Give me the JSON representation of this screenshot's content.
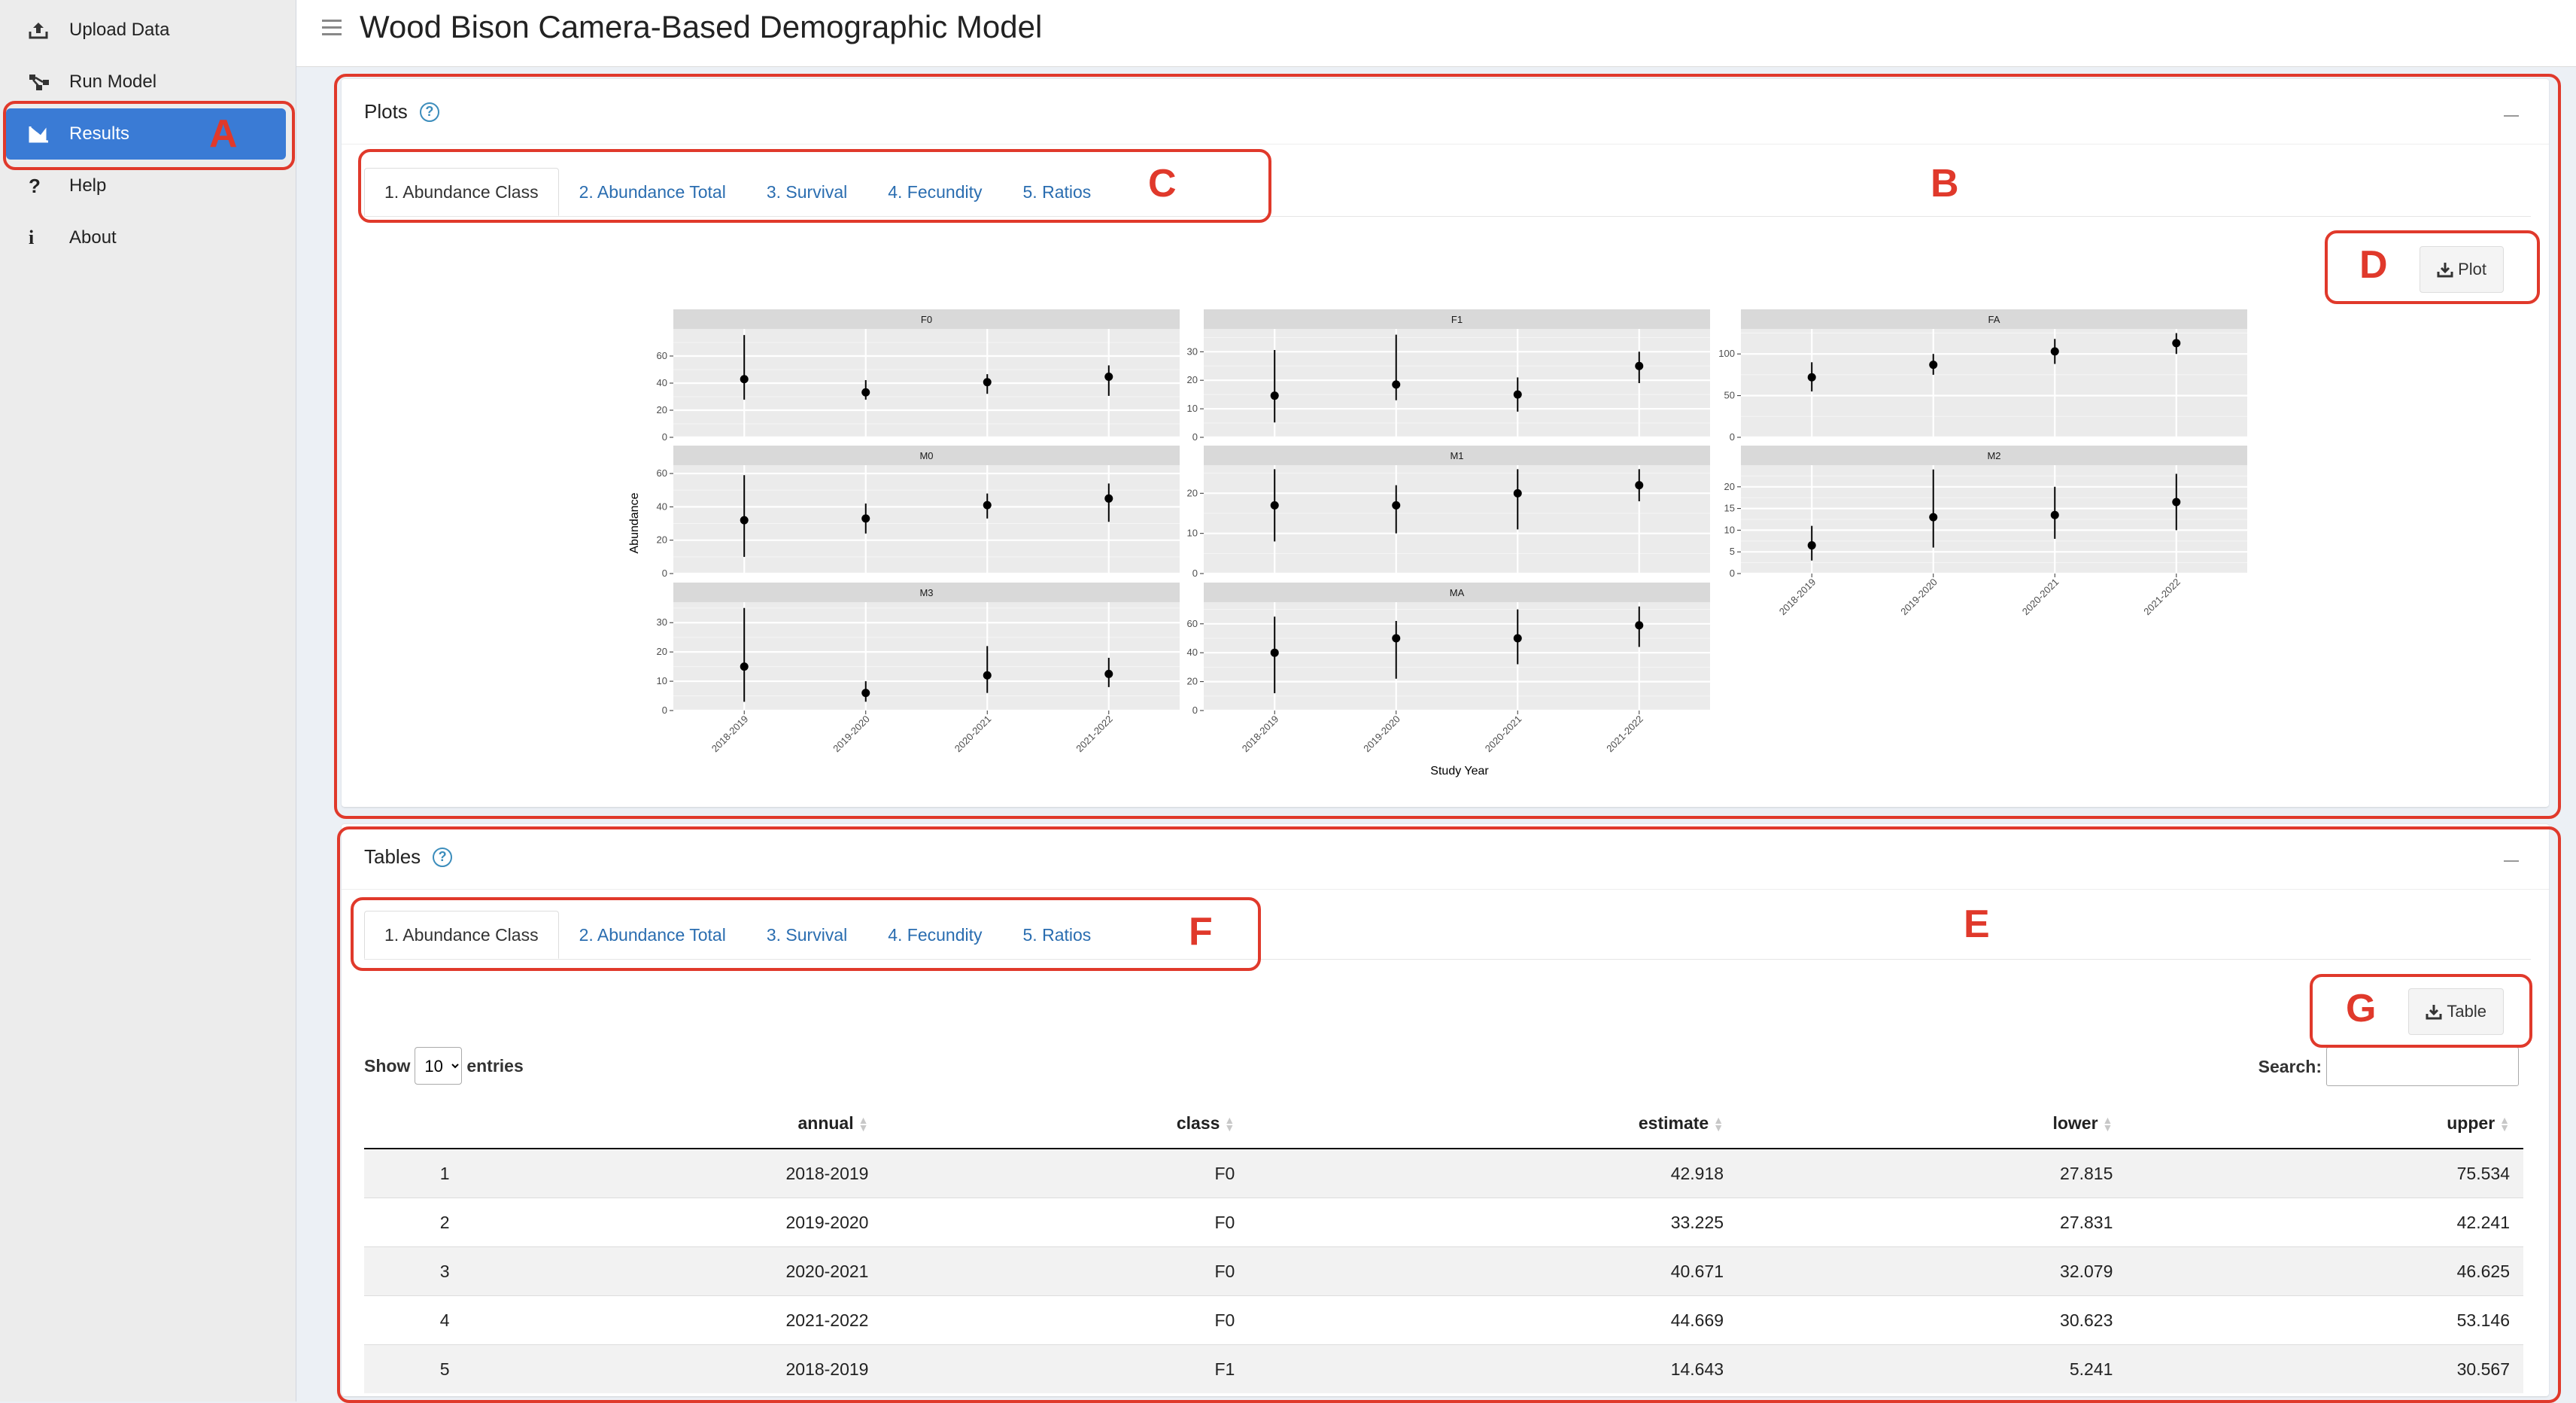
{
  "sidebar": {
    "items": [
      {
        "label": "Upload Data",
        "icon": "upload-icon",
        "active": false
      },
      {
        "label": "Run Model",
        "icon": "model-network-icon",
        "active": false
      },
      {
        "label": "Results",
        "icon": "bar-chart-icon",
        "active": true
      },
      {
        "label": "Help",
        "icon": "question-icon",
        "active": false
      },
      {
        "label": "About",
        "icon": "info-icon",
        "active": false
      }
    ]
  },
  "header": {
    "title": "Wood Bison Camera-Based Demographic Model"
  },
  "plots_box": {
    "title": "Plots",
    "tabs": [
      "1. Abundance Class",
      "2. Abundance Total",
      "3. Survival",
      "4. Fecundity",
      "5. Ratios"
    ],
    "active_tab": 0,
    "download_label": "Plot"
  },
  "tables_box": {
    "title": "Tables",
    "tabs": [
      "1. Abundance Class",
      "2. Abundance Total",
      "3. Survival",
      "4. Fecundity",
      "5. Ratios"
    ],
    "active_tab": 0,
    "download_label": "Table",
    "show_label": "Show",
    "entries_label": "entries",
    "page_length": "10",
    "search_label": "Search:",
    "search_value": "",
    "columns": [
      "",
      "annual",
      "class",
      "estimate",
      "lower",
      "upper"
    ],
    "rows": [
      [
        "1",
        "2018-2019",
        "F0",
        "42.918",
        "27.815",
        "75.534"
      ],
      [
        "2",
        "2019-2020",
        "F0",
        "33.225",
        "27.831",
        "42.241"
      ],
      [
        "3",
        "2020-2021",
        "F0",
        "40.671",
        "32.079",
        "46.625"
      ],
      [
        "4",
        "2021-2022",
        "F0",
        "44.669",
        "30.623",
        "53.146"
      ],
      [
        "5",
        "2018-2019",
        "F1",
        "14.643",
        "5.241",
        "30.567"
      ]
    ]
  },
  "annotations": [
    "A",
    "B",
    "C",
    "D",
    "E",
    "F",
    "G"
  ],
  "colors": {
    "annotation": "#e0392b",
    "active_nav": "#3a7bd5",
    "tab_link": "#2a6db0"
  },
  "chart_data": {
    "type": "scatter",
    "subtype": "faceted point-range",
    "xlabel": "Study Year",
    "ylabel": "Abundance",
    "categories": [
      "2018-2019",
      "2019-2020",
      "2020-2021",
      "2021-2022"
    ],
    "facets": [
      {
        "name": "F0",
        "ticks": [
          0,
          20,
          40,
          60
        ],
        "ylim": [
          0,
          80
        ],
        "points": [
          {
            "estimate": 42.9,
            "lower": 27.8,
            "upper": 75.5
          },
          {
            "estimate": 33.2,
            "lower": 27.8,
            "upper": 42.2
          },
          {
            "estimate": 40.7,
            "lower": 32.1,
            "upper": 46.6
          },
          {
            "estimate": 44.7,
            "lower": 30.6,
            "upper": 53.1
          }
        ]
      },
      {
        "name": "F1",
        "ticks": [
          0,
          10,
          20,
          30
        ],
        "ylim": [
          0,
          38
        ],
        "points": [
          {
            "estimate": 14.6,
            "lower": 5.2,
            "upper": 30.6
          },
          {
            "estimate": 18.5,
            "lower": 13,
            "upper": 36
          },
          {
            "estimate": 15,
            "lower": 9,
            "upper": 21
          },
          {
            "estimate": 25,
            "lower": 19,
            "upper": 30
          }
        ]
      },
      {
        "name": "FA",
        "ticks": [
          0,
          50,
          100
        ],
        "ylim": [
          0,
          130
        ],
        "points": [
          {
            "estimate": 72,
            "lower": 55,
            "upper": 90
          },
          {
            "estimate": 87,
            "lower": 75,
            "upper": 100
          },
          {
            "estimate": 103,
            "lower": 88,
            "upper": 118
          },
          {
            "estimate": 113,
            "lower": 100,
            "upper": 125
          }
        ]
      },
      {
        "name": "M0",
        "ticks": [
          0,
          20,
          40,
          60
        ],
        "ylim": [
          0,
          65
        ],
        "points": [
          {
            "estimate": 32,
            "lower": 10,
            "upper": 59
          },
          {
            "estimate": 33,
            "lower": 24,
            "upper": 42
          },
          {
            "estimate": 41,
            "lower": 33,
            "upper": 48
          },
          {
            "estimate": 45,
            "lower": 31,
            "upper": 54
          }
        ]
      },
      {
        "name": "M1",
        "ticks": [
          0,
          10,
          20
        ],
        "ylim": [
          0,
          27
        ],
        "points": [
          {
            "estimate": 17,
            "lower": 8,
            "upper": 26
          },
          {
            "estimate": 17,
            "lower": 10,
            "upper": 22
          },
          {
            "estimate": 20,
            "lower": 11,
            "upper": 26
          },
          {
            "estimate": 22,
            "lower": 18,
            "upper": 26
          }
        ]
      },
      {
        "name": "M2",
        "ticks": [
          0,
          5,
          10,
          15,
          20
        ],
        "ylim": [
          0,
          25
        ],
        "points": [
          {
            "estimate": 6.5,
            "lower": 3,
            "upper": 11
          },
          {
            "estimate": 13,
            "lower": 6,
            "upper": 24
          },
          {
            "estimate": 13.5,
            "lower": 8,
            "upper": 20
          },
          {
            "estimate": 16.5,
            "lower": 10,
            "upper": 23
          }
        ]
      },
      {
        "name": "M3",
        "ticks": [
          0,
          10,
          20,
          30
        ],
        "ylim": [
          0,
          37
        ],
        "points": [
          {
            "estimate": 15,
            "lower": 3,
            "upper": 35
          },
          {
            "estimate": 6,
            "lower": 3,
            "upper": 10
          },
          {
            "estimate": 12,
            "lower": 6,
            "upper": 22
          },
          {
            "estimate": 12.5,
            "lower": 8,
            "upper": 18
          }
        ]
      },
      {
        "name": "MA",
        "ticks": [
          0,
          20,
          40,
          60
        ],
        "ylim": [
          0,
          75
        ],
        "points": [
          {
            "estimate": 40,
            "lower": 12,
            "upper": 65
          },
          {
            "estimate": 50,
            "lower": 22,
            "upper": 62
          },
          {
            "estimate": 50,
            "lower": 32,
            "upper": 70
          },
          {
            "estimate": 59,
            "lower": 44,
            "upper": 72
          }
        ]
      }
    ]
  }
}
